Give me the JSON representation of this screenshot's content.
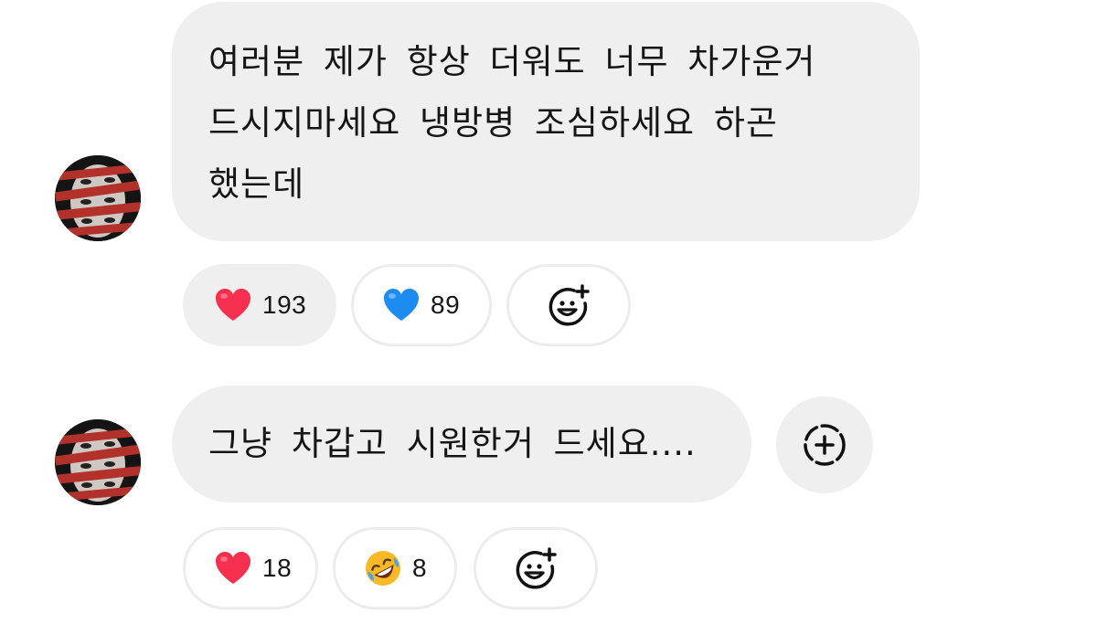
{
  "thread": {
    "comments": [
      {
        "text_lines": [
          "여러분 제가 항상 더워도 너무 차가운거",
          "드시지마세요 냉방병 조심하세요 하곤",
          "했는데"
        ],
        "reactions": [
          {
            "emoji": "red-heart",
            "count": "193",
            "selected": true
          },
          {
            "emoji": "blue-heart",
            "count": "89",
            "selected": false
          }
        ]
      },
      {
        "text": "그냥 차갑고 시원한거 드세요....",
        "reactions": [
          {
            "emoji": "red-heart",
            "count": "18",
            "selected": false
          },
          {
            "emoji": "rolling-on-floor-laughing",
            "count": "8",
            "selected": false
          }
        ]
      }
    ]
  },
  "colors": {
    "bubble_bg": "#efefef",
    "pill_border": "#ececec",
    "red_heart": "#f5304f",
    "blue_heart": "#1c8cf0",
    "laugh_face": "#f7b928"
  }
}
